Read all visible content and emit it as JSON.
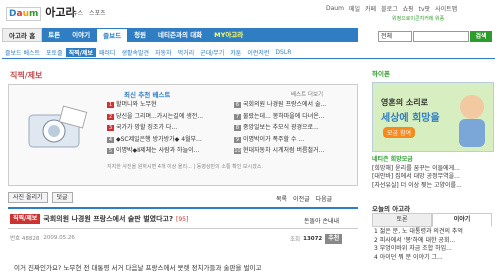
{
  "header": {
    "logo_daum": "Daum",
    "logo_agora": "아고라",
    "top_nav": [
      "뉴스",
      "스포츠"
    ],
    "top_right_links": [
      "Daum",
      "메일",
      "카페",
      "블로그",
      "쇼핑",
      "tv팟",
      "사이트맵"
    ],
    "hope_text": "위정으로이콘지커에 위풍",
    "search_label": "전체",
    "search_button": "검색"
  },
  "main_nav": {
    "tabs": [
      "아고라 홈",
      "토론",
      "이야기",
      "즐보드",
      "청원",
      "네티즌과의 대화",
      "MY아고라"
    ]
  },
  "sub_nav": {
    "items": [
      "즐보드 베스트",
      "포토즐",
      "직찍/제보",
      "패러디",
      "생활속발견",
      "자동차",
      "먹거리",
      "군대/무기",
      "카툰",
      "이런저런",
      "DSLR"
    ]
  },
  "page": {
    "section_title": "직찍/제보",
    "best_title": "최신 추천 베스트",
    "best_more": "베스트 더보기",
    "best_left": [
      {
        "n": "1",
        "t": "할머니와 노무현"
      },
      {
        "n": "2",
        "t": "당신을 그리며...가시는길에 생전..."
      },
      {
        "n": "3",
        "t": "국가가 망할 징조가 다..."
      },
      {
        "n": "4",
        "t": "◆SC제일은행 방가방가◆ 4월부..."
      },
      {
        "n": "5",
        "t": "이명박◆Ⅱ제체는 사람과 하늘이..."
      }
    ],
    "best_right": [
      {
        "n": "6",
        "t": "국회의원 나경원 프랑스에서 술..."
      },
      {
        "n": "7",
        "t": "물랐는데... 봉하마을에 다녀온..."
      },
      {
        "n": "8",
        "t": "중앙일보는 추모식 광경으로..."
      },
      {
        "n": "9",
        "t": "이명박이가 폭주할 수 ..."
      },
      {
        "n": "10",
        "t": "현대자동차 시계처럼 버름철거..."
      }
    ],
    "best_note": "지지한 사진을 원하시면 4개 이상 올리... | 동영상만의 소통 확인 보시겠소.",
    "btn_post": "사진 올리기",
    "btn_reply": "덧글",
    "list_nav": [
      "목록",
      "이전글",
      "다음글"
    ],
    "article_tag": "직찍/제보",
    "article_title": "국회의원 나경원 프랑스에서 술판 벌였다고?",
    "article_count": "[95]",
    "article_author": "돈돌아 손내내",
    "meta_num": "번호 48828",
    "meta_date": "2009.05.26",
    "meta_views": "조회",
    "meta_views_value": "13072",
    "meta_recommend": "추천",
    "body_text": "이거 진짜인가요? 노무현 전 대통령 서거 다음날 프랑스에서 뭇렛 정치가들과 술판을 벌이고"
  },
  "sidebar": {
    "title": "하이폰",
    "ad_line1": "영혼의 소리로",
    "ad_line2": "세상에 희망을",
    "ad_button": "모금 참여",
    "links": [
      "네티즌 희망모금",
      "[희망해] 윤리를 꿈꾸는 이들에게...",
      "[대안바] 집에서 대망 공정무역을...",
      "[자선유실] 더 이상 찢는 고양이를..."
    ],
    "today_title": "오늘의 아고라",
    "tabs": [
      "토론",
      "이야기"
    ],
    "today_list": [
      "1 젊은 분, 노 대통령과 의견의 추억",
      "2 피사에서 '봉'하에 대한 공회...",
      "3 부엉이바위 자금 조합 하임...",
      "4 아이던 뭐 분 이야기 그..."
    ]
  },
  "colors": {
    "accent": "#2f7ec3",
    "brand": "#2d9c2d",
    "badge": "#c33"
  }
}
